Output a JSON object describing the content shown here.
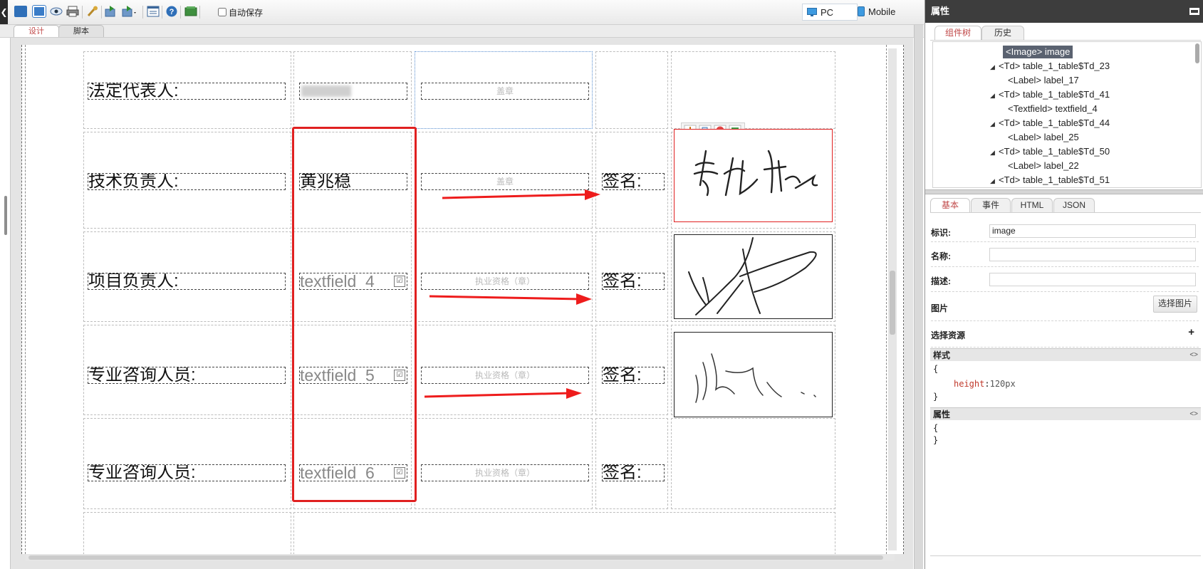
{
  "toolbar": {
    "autosave_label": "自动保存",
    "pc_label": "PC",
    "mobile_label": "Mobile"
  },
  "design_tabs": {
    "design": "设计",
    "script": "脚本"
  },
  "form": {
    "row1": {
      "label": "法定代表人:",
      "value_blurred": "",
      "stamp": "盖章"
    },
    "row2": {
      "label": "技术负责人:",
      "value": "黄兆稳",
      "stamp": "盖章",
      "sign_label": "签名:"
    },
    "row3": {
      "label": "项目负责人:",
      "field": "textfield_4",
      "stamp": "执业资格（章）",
      "sign_label": "签名:"
    },
    "row4": {
      "label": "专业咨询人员:",
      "field": "textfield_5",
      "stamp": "执业资格（章）",
      "sign_label": "签名:"
    },
    "row5": {
      "label": "专业咨询人员:",
      "field": "textfield_6",
      "stamp": "执业资格（章）",
      "sign_label": "签名:"
    }
  },
  "panel": {
    "title": "属性",
    "top_tabs": [
      "组件树",
      "历史"
    ],
    "tree": [
      "<Image> image",
      "<Td> table_1_table$Td_23",
      "<Label> label_17",
      "<Td> table_1_table$Td_41",
      "<Textfield> textfield_4",
      "<Td> table_1_table$Td_44",
      "<Label> label_25",
      "<Td> table_1_table$Td_50",
      "<Label> label_22",
      "<Td> table_1_table$Td_51"
    ],
    "prop_tabs": [
      "基本",
      "事件",
      "HTML",
      "JSON"
    ],
    "fields": {
      "id_label": "标识:",
      "id_value": "image",
      "name_label": "名称:",
      "name_value": "",
      "desc_label": "描述:",
      "desc_value": ""
    },
    "image_label": "图片",
    "choose_image": "选择图片",
    "resource_label": "选择资源",
    "resource_add": "+",
    "style_header": "样式",
    "style_open": "{",
    "style_key": "height",
    "style_colon": ":",
    "style_value": "120px",
    "style_close": "}",
    "attr_header": "属性",
    "attr_open": "{",
    "attr_close": "}",
    "code_icon": "<>"
  },
  "colors": {
    "selection": "#e02020",
    "arrow": "#ee1c1c",
    "header": "#3d3d3d",
    "active_tab": "#c04848"
  },
  "icons": [
    "save-icon",
    "save-as-icon",
    "preview-icon",
    "print-icon",
    "tools-icon",
    "import-icon",
    "export-icon",
    "list-icon",
    "help-icon",
    "image-icon",
    "move-icon",
    "copy-icon",
    "delete-icon",
    "replace-icon"
  ]
}
